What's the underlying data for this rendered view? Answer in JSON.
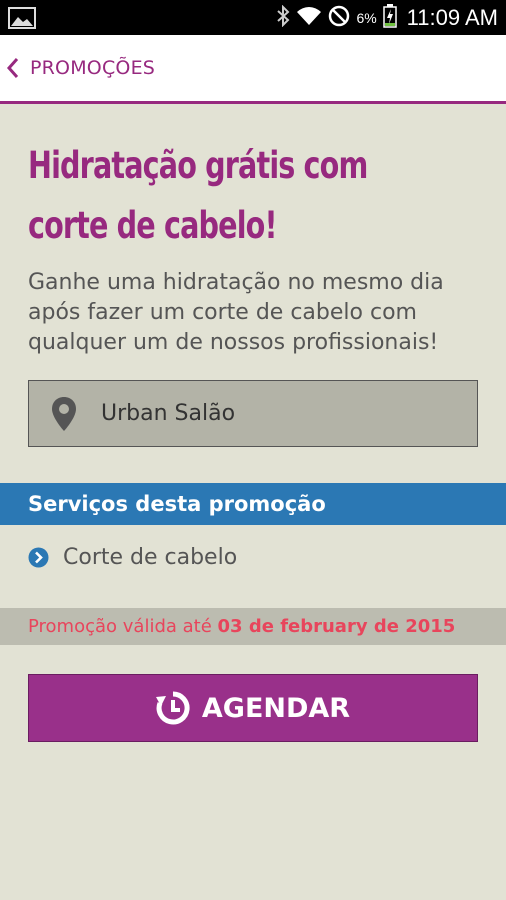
{
  "status_bar": {
    "battery_percent": "6%",
    "time": "11:09 AM",
    "icons": [
      "image-icon",
      "bluetooth-icon",
      "wifi-icon",
      "do-not-disturb-icon",
      "battery-charging-icon"
    ]
  },
  "app_bar": {
    "title": "PROMOÇÕES",
    "back_icon": "chevron-left-icon"
  },
  "promo": {
    "headline_line1": "Hidratação grátis com",
    "headline_line2": "corte de cabelo!",
    "description_line1": "Ganhe uma hidratação no mesmo dia",
    "description_line2": "após fazer um corte de cabelo com",
    "description_line3": "qualquer um de nossos profissionais!",
    "location": "Urban Salão",
    "location_icon": "map-pin-icon"
  },
  "services": {
    "header": "Serviços desta promoção",
    "items": [
      "Corte de cabelo"
    ],
    "bullet_icon": "chevron-circle-right-icon"
  },
  "validity": {
    "prefix": "Promoção válida até ",
    "date": "03 de february de 2015"
  },
  "cta": {
    "label": "AGENDAR",
    "icon": "schedule-clock-icon"
  },
  "colors": {
    "brand_purple": "#97297f",
    "button_purple": "#99308a",
    "services_blue": "#2b78b4",
    "background": "#e2e2d4",
    "validity_red": "#e8455c"
  }
}
